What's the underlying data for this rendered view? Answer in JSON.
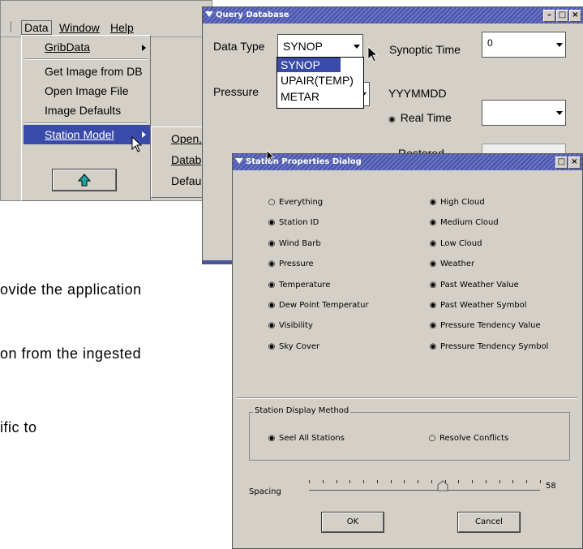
{
  "menubar": {
    "items": [
      "Data",
      "Window",
      "Help"
    ]
  },
  "data_menu": {
    "items": [
      "GribData",
      "Get Image from DB",
      "Open Image File",
      "Image Defaults",
      "Station Model"
    ],
    "up_button_icon": "up-arrow-icon"
  },
  "station_submenu": {
    "items": [
      "Open.",
      "Datab",
      "Defau"
    ]
  },
  "query_dialog": {
    "title": "Query Database",
    "data_type_label": "Data Type",
    "data_type_value": "SYNOP",
    "data_type_options": [
      "SYNOP",
      "UPAIR(TEMP)",
      "METAR"
    ],
    "synoptic_time_label": "Synoptic Time",
    "synoptic_time_value": "0",
    "pressure_label": "Pressure",
    "date_format_label": "YYYMMDD",
    "real_time_label": "Real Time",
    "restored_label": "Restored"
  },
  "station_dialog": {
    "title": "Station Properties Dialog",
    "left_options": [
      {
        "label": "Everything",
        "selected": false
      },
      {
        "label": "Station ID",
        "selected": true
      },
      {
        "label": "Wind Barb",
        "selected": true
      },
      {
        "label": "Pressure",
        "selected": true
      },
      {
        "label": "Temperature",
        "selected": true
      },
      {
        "label": "Dew Point Temperatur",
        "selected": true
      },
      {
        "label": "Visibility",
        "selected": true
      },
      {
        "label": "Sky Cover",
        "selected": true
      }
    ],
    "right_options": [
      {
        "label": "High Cloud",
        "selected": true
      },
      {
        "label": "Medium Cloud",
        "selected": true
      },
      {
        "label": "Low Cloud",
        "selected": true
      },
      {
        "label": "Weather",
        "selected": true
      },
      {
        "label": "Past Weather Value",
        "selected": true
      },
      {
        "label": "Past Weather Symbol",
        "selected": true
      },
      {
        "label": "Pressure Tendency Value",
        "selected": true
      },
      {
        "label": "Pressure Tendency Symbol",
        "selected": true
      }
    ],
    "display_group_label": "Station Display Method",
    "display_options": [
      {
        "label": "Seel All Stations",
        "selected": true
      },
      {
        "label": "Resolve Conflicts",
        "selected": false
      }
    ],
    "spacing_label": "Spacing",
    "spacing_value": "58",
    "spacing_fraction": 0.58,
    "ok_label": "OK",
    "cancel_label": "Cancel"
  },
  "background_text": [
    "ovide  the  application",
    "on from the ingested",
    "ific to"
  ],
  "colors": {
    "titlebar": "#4a55a8",
    "selection": "#3a4aa8",
    "window_bg": "#d4d0c8"
  }
}
